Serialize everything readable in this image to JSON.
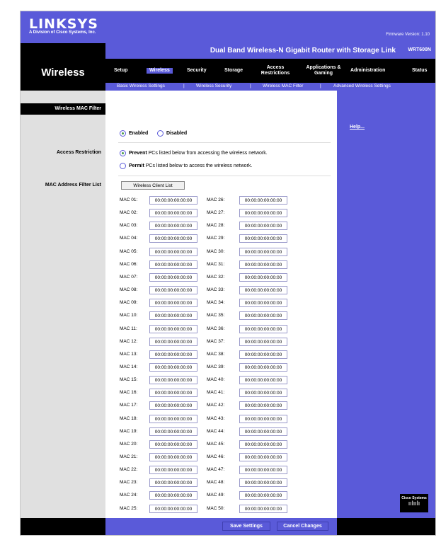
{
  "header": {
    "logo": "LINKSYS",
    "logo_sub": "A Division of Cisco Systems, Inc.",
    "firmware": "Firmware Version: 1.10"
  },
  "product": {
    "name": "Dual Band Wireless-N Gigabit Router with Storage Link",
    "model": "WRT600N"
  },
  "section_title": "Wireless",
  "nav": [
    {
      "label": "Setup"
    },
    {
      "label": "Wireless",
      "active": true
    },
    {
      "label": "Security"
    },
    {
      "label": "Storage"
    },
    {
      "label": "Access Restrictions"
    },
    {
      "label": "Applications & Gaming"
    },
    {
      "label": "Administration"
    },
    {
      "label": "Status"
    }
  ],
  "subnav": {
    "basic": "Basic Wireless Settings",
    "security": "Wireless Security",
    "mac_filter": "Wireless MAC Filter",
    "advanced": "Advanced Wireless Settings"
  },
  "left": {
    "mac_filter_title": "Wireless MAC Filter",
    "access_restriction": "Access Restriction",
    "mac_list": "MAC Address Filter List"
  },
  "filter": {
    "enabled": "Enabled",
    "disabled": "Disabled",
    "prevent_bold": "Prevent",
    "prevent_rest": "PCs listed below from accessing the wireless network.",
    "permit_bold": "Permit",
    "permit_rest": "PCs listed below to access the wireless network.",
    "client_list_btn": "Wireless Client List"
  },
  "help": "Help...",
  "buttons": {
    "save": "Save Settings",
    "cancel": "Cancel Changes"
  },
  "cisco": "Cisco Systems",
  "mac_rows": [
    {
      "l": "MAC 01:",
      "lv": "00:00:00:00:00:00",
      "r": "MAC 26:",
      "rv": "00:00:00:00:00:00"
    },
    {
      "l": "MAC 02:",
      "lv": "00:00:00:00:00:00",
      "r": "MAC 27:",
      "rv": "00:00:00:00:00:00"
    },
    {
      "l": "MAC 03:",
      "lv": "00:00:00:00:00:00",
      "r": "MAC 28:",
      "rv": "00:00:00:00:00:00"
    },
    {
      "l": "MAC 04:",
      "lv": "00:00:00:00:00:00",
      "r": "MAC 29:",
      "rv": "00:00:00:00:00:00"
    },
    {
      "l": "MAC 05:",
      "lv": "00:00:00:00:00:00",
      "r": "MAC 30:",
      "rv": "00:00:00:00:00:00"
    },
    {
      "l": "MAC 06:",
      "lv": "00:00:00:00:00:00",
      "r": "MAC 31:",
      "rv": "00:00:00:00:00:00"
    },
    {
      "l": "MAC 07:",
      "lv": "00:00:00:00:00:00",
      "r": "MAC 32:",
      "rv": "00:00:00:00:00:00"
    },
    {
      "l": "MAC 08:",
      "lv": "00:00:00:00:00:00",
      "r": "MAC 33:",
      "rv": "00:00:00:00:00:00"
    },
    {
      "l": "MAC 09:",
      "lv": "00:00:00:00:00:00",
      "r": "MAC 34:",
      "rv": "00:00:00:00:00:00"
    },
    {
      "l": "MAC 10:",
      "lv": "00:00:00:00:00:00",
      "r": "MAC 35:",
      "rv": "00:00:00:00:00:00"
    },
    {
      "l": "MAC 11:",
      "lv": "00:00:00:00:00:00",
      "r": "MAC 36:",
      "rv": "00:00:00:00:00:00"
    },
    {
      "l": "MAC 12:",
      "lv": "00:00:00:00:00:00",
      "r": "MAC 37:",
      "rv": "00:00:00:00:00:00"
    },
    {
      "l": "MAC 13:",
      "lv": "00:00:00:00:00:00",
      "r": "MAC 38:",
      "rv": "00:00:00:00:00:00"
    },
    {
      "l": "MAC 14:",
      "lv": "00:00:00:00:00:00",
      "r": "MAC 39:",
      "rv": "00:00:00:00:00:00"
    },
    {
      "l": "MAC 15:",
      "lv": "00:00:00:00:00:00",
      "r": "MAC 40:",
      "rv": "00:00:00:00:00:00"
    },
    {
      "l": "MAC 16:",
      "lv": "00:00:00:00:00:00",
      "r": "MAC 41:",
      "rv": "00:00:00:00:00:00"
    },
    {
      "l": "MAC 17:",
      "lv": "00:00:00:00:00:00",
      "r": "MAC 42:",
      "rv": "00:00:00:00:00:00"
    },
    {
      "l": "MAC 18:",
      "lv": "00:00:00:00:00:00",
      "r": "MAC 43:",
      "rv": "00:00:00:00:00:00"
    },
    {
      "l": "MAC 19:",
      "lv": "00:00:00:00:00:00",
      "r": "MAC 44:",
      "rv": "00:00:00:00:00:00"
    },
    {
      "l": "MAC 20:",
      "lv": "00:00:00:00:00:00",
      "r": "MAC 45:",
      "rv": "00:00:00:00:00:00"
    },
    {
      "l": "MAC 21:",
      "lv": "00:00:00:00:00:00",
      "r": "MAC 46:",
      "rv": "00:00:00:00:00:00"
    },
    {
      "l": "MAC 22:",
      "lv": "00:00:00:00:00:00",
      "r": "MAC 47:",
      "rv": "00:00:00:00:00:00"
    },
    {
      "l": "MAC 23:",
      "lv": "00:00:00:00:00:00",
      "r": "MAC 48:",
      "rv": "00:00:00:00:00:00"
    },
    {
      "l": "MAC 24:",
      "lv": "00:00:00:00:00:00",
      "r": "MAC 49:",
      "rv": "00:00:00:00:00:00"
    },
    {
      "l": "MAC 25:",
      "lv": "00:00:00:00:00:00",
      "r": "MAC 50:",
      "rv": "00:00:00:00:00:00"
    }
  ]
}
